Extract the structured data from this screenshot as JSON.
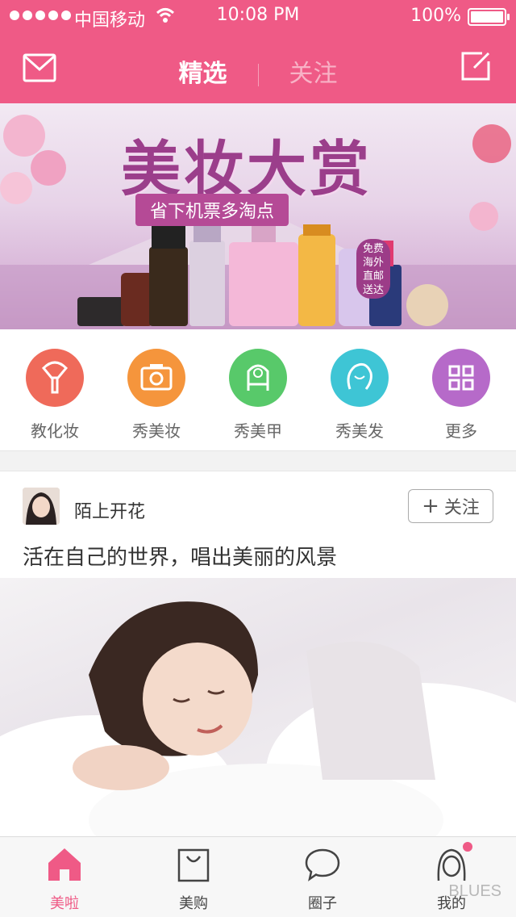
{
  "status_bar": {
    "carrier": "中国移动",
    "time": "10:08 PM",
    "battery": "100%"
  },
  "header": {
    "tabs": [
      {
        "label": "精选"
      },
      {
        "label": "关注"
      }
    ],
    "active_tab": "精选",
    "accent_color": "#ef5a86",
    "left_icon": "mail-icon",
    "right_icon": "compose-icon"
  },
  "banner": {
    "title": "美妆大赏",
    "subtitle": "省下机票多淘点",
    "badge": "免费海外直邮送达"
  },
  "categories": [
    {
      "label": "教化妆",
      "icon": "makeup-brush-icon",
      "color": "#ef6a5a"
    },
    {
      "label": "秀美妆",
      "icon": "camera-icon",
      "color": "#f5953c"
    },
    {
      "label": "秀美甲",
      "icon": "nail-icon",
      "color": "#58c96a"
    },
    {
      "label": "秀美发",
      "icon": "hair-icon",
      "color": "#3ec5d5"
    },
    {
      "label": "更多",
      "icon": "grid-icon",
      "color": "#b66ac9"
    }
  ],
  "post": {
    "username": "陌上开花",
    "follow_label": "关注",
    "caption": "活在自己的世界，唱出美丽的风景"
  },
  "tab_bar": {
    "items": [
      {
        "label": "美啦",
        "icon": "home-icon"
      },
      {
        "label": "美购",
        "icon": "shopping-bag-icon"
      },
      {
        "label": "圈子",
        "icon": "chat-bubble-icon"
      },
      {
        "label": "我的",
        "icon": "profile-icon"
      }
    ],
    "active": "美啦",
    "watermark": "BLUES"
  }
}
